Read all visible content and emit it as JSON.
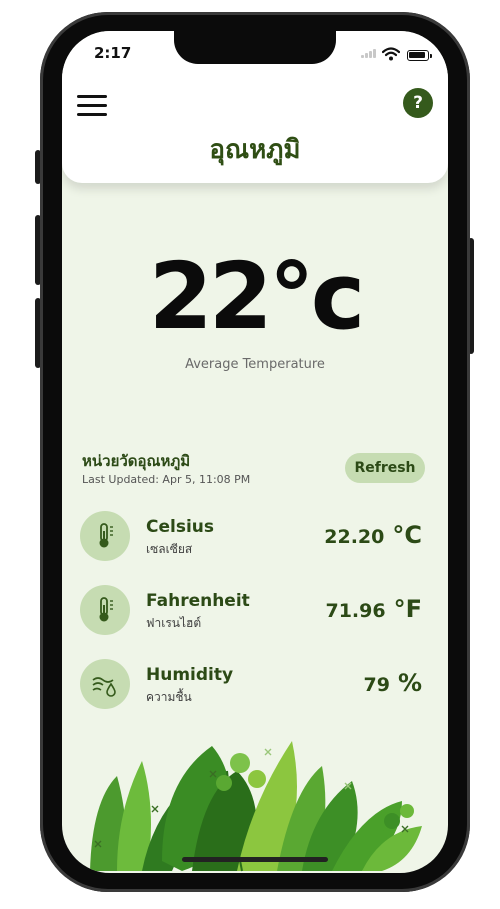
{
  "status_bar": {
    "time": "2:17"
  },
  "header": {
    "title": "อุณหภูมิ",
    "help_label": "?"
  },
  "summary": {
    "value": "22°c",
    "label": "Average Temperature"
  },
  "units_section": {
    "title": "หน่วยวัดอุณหภูมิ",
    "last_updated": "Last Updated: Apr 5, 11:08 PM",
    "refresh_label": "Refresh"
  },
  "rows": [
    {
      "title": "Celsius",
      "subtitle": "เซลเซียส",
      "value": "22.20",
      "unit": "°C",
      "icon": "thermometer-icon"
    },
    {
      "title": "Fahrenheit",
      "subtitle": "ฟาเรนไฮต์",
      "value": "71.96",
      "unit": "°F",
      "icon": "thermometer-icon"
    },
    {
      "title": "Humidity",
      "subtitle": "ความชื้น",
      "value": "79",
      "unit": "%",
      "icon": "humidity-icon"
    }
  ],
  "colors": {
    "accent": "#2f4e14",
    "background": "#eff5e8",
    "chip": "#c6dcb2"
  }
}
